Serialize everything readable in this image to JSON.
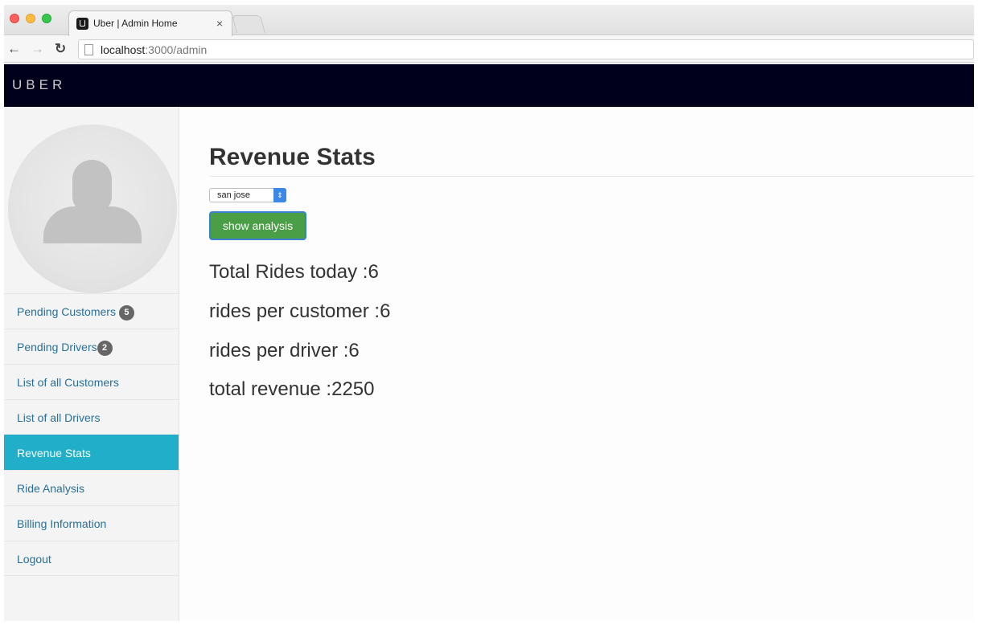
{
  "browser": {
    "tab_title": "Uber | Admin Home",
    "tab_close": "×",
    "url_host": "localhost",
    "url_path": ":3000/admin"
  },
  "app": {
    "brand": "UBER"
  },
  "sidebar": {
    "items": [
      {
        "label": "Pending Customers",
        "badge": "5"
      },
      {
        "label": "Pending Drivers",
        "badge": "2"
      },
      {
        "label": "List of all Customers"
      },
      {
        "label": "List of all Drivers"
      },
      {
        "label": "Revenue Stats",
        "active": true
      },
      {
        "label": "Ride Analysis"
      },
      {
        "label": "Billing Information"
      },
      {
        "label": "Logout"
      }
    ]
  },
  "main": {
    "title": "Revenue Stats",
    "city_select": {
      "value": "san jose"
    },
    "show_button": "show analysis",
    "stats": {
      "total_rides": "Total Rides today :6",
      "rides_per_customer": "rides per customer :6",
      "rides_per_driver": "rides per driver :6",
      "total_revenue": "total revenue :2250"
    }
  },
  "colors": {
    "header_bg": "#00001a",
    "active_nav": "#21aec8",
    "button_green": "#4a9e45",
    "link": "#2a6f97"
  },
  "icons": [
    "back-arrow-icon",
    "forward-arrow-icon",
    "reload-icon",
    "page-icon",
    "avatar-silhouette-icon",
    "select-arrows-icon"
  ]
}
